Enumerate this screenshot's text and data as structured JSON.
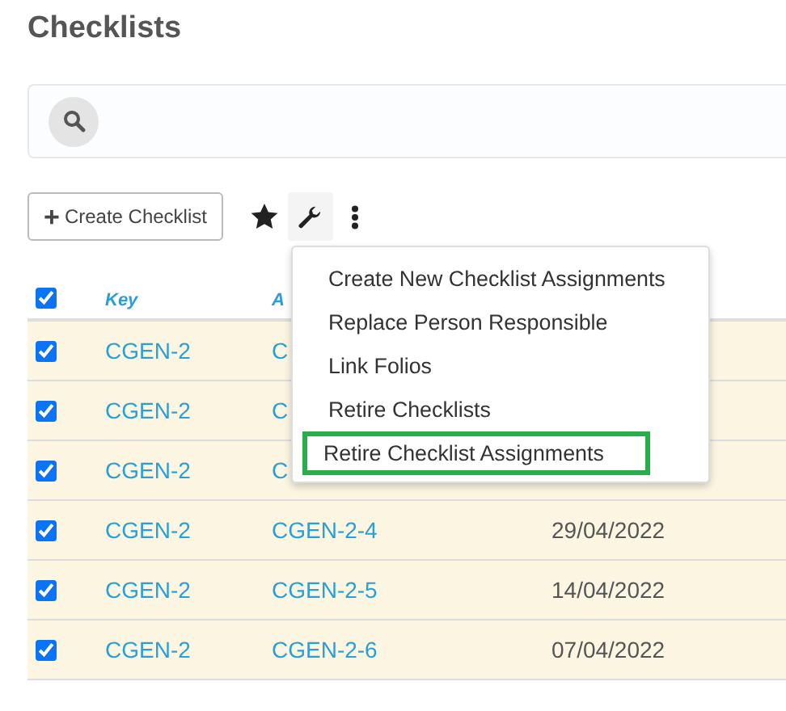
{
  "title": "Checklists",
  "toolbar": {
    "create_button": "Create Checklist",
    "create_icon": "+"
  },
  "table": {
    "all_checked": true,
    "columns": [
      "Key",
      "A"
    ],
    "rows": [
      {
        "checked": true,
        "key": "CGEN-2",
        "column_2": "C"
      },
      {
        "checked": true,
        "key": "CGEN-2",
        "column_2": "C"
      },
      {
        "checked": true,
        "key": "CGEN-2",
        "column_2": "C"
      },
      {
        "checked": true,
        "key": "CGEN-2",
        "column_2": "CGEN-2-4",
        "date": "29/04/2022"
      },
      {
        "checked": true,
        "key": "CGEN-2",
        "column_2": "CGEN-2-5",
        "date": "14/04/2022"
      },
      {
        "checked": true,
        "key": "CGEN-2",
        "column_2": "CGEN-2-6",
        "date": "07/04/2022"
      }
    ]
  },
  "menu": {
    "items": [
      {
        "label": "Create New Checklist Assignments",
        "highlighted": false
      },
      {
        "label": "Replace Person Responsible",
        "highlighted": false
      },
      {
        "label": "Link Folios",
        "highlighted": false
      },
      {
        "label": "Retire Checklists",
        "highlighted": false
      },
      {
        "label": "Retire Checklist Assignments",
        "highlighted": true
      }
    ]
  }
}
